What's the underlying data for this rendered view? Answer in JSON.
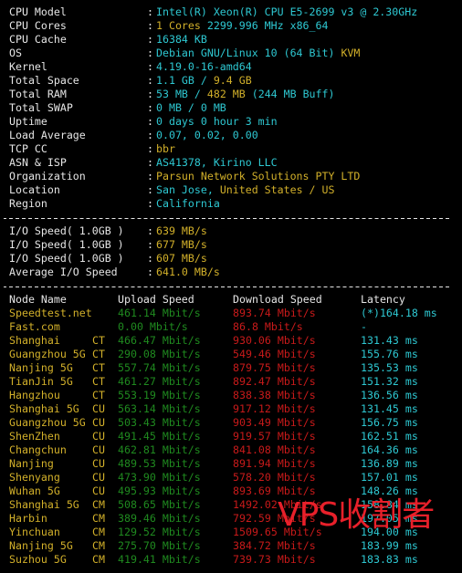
{
  "colors": {
    "label": "#e6e6e6",
    "cyan": "#2ec8d2",
    "yellow": "#d2b02a",
    "green": "#1f8a1f",
    "red": "#c81a1a",
    "watermark": "#e8202a"
  },
  "system": {
    "cpu_model": {
      "label": "CPU Model",
      "value": "Intel(R) Xeon(R) CPU E5-2699 v3 @ 2.30GHz"
    },
    "cpu_cores": {
      "label": "CPU Cores",
      "count": "1 Cores",
      "rest": "2299.996 MHz x86_64"
    },
    "cpu_cache": {
      "label": "CPU Cache",
      "value": "16384 KB"
    },
    "os": {
      "label": "OS",
      "value": "Debian GNU/Linux 10 (64 Bit)",
      "virt": "KVM"
    },
    "kernel": {
      "label": "Kernel",
      "value": "4.19.0-16-amd64"
    },
    "total_space": {
      "label": "Total Space",
      "used": "1.1 GB /",
      "total": "9.4 GB"
    },
    "total_ram": {
      "label": "Total RAM",
      "used": "53 MB /",
      "total": "482 MB",
      "extra": "(244 MB Buff)"
    },
    "total_swap": {
      "label": "Total SWAP",
      "value": "0 MB / 0 MB"
    },
    "uptime": {
      "label": "Uptime",
      "value": "0 days 0 hour 3 min"
    },
    "load_average": {
      "label": "Load Average",
      "value": "0.07, 0.02, 0.00"
    },
    "tcp_cc": {
      "label": "TCP CC",
      "value": "bbr"
    },
    "asn_isp": {
      "label": "ASN & ISP",
      "value": "AS41378, Kirino LLC"
    },
    "organization": {
      "label": "Organization",
      "value": "Parsun Network Solutions PTY LTD"
    },
    "location": {
      "label": "Location",
      "city": "San Jose,",
      "country": "United States / US"
    },
    "region": {
      "label": "Region",
      "value": "California"
    }
  },
  "separator_colon": ":",
  "io": [
    {
      "label": "I/O Speed( 1.0GB )",
      "value": "639 MB/s"
    },
    {
      "label": "I/O Speed( 1.0GB )",
      "value": "677 MB/s"
    },
    {
      "label": "I/O Speed( 1.0GB )",
      "value": "607 MB/s"
    },
    {
      "label": "Average I/O Speed",
      "value": "641.0 MB/s"
    }
  ],
  "speedtest": {
    "headers": {
      "node": "Node Name",
      "upload": "Upload Speed",
      "download": "Download Speed",
      "latency": "Latency"
    },
    "rows": [
      {
        "node": "Speedtest.net",
        "isp": "",
        "upload": "461.14 Mbit/s",
        "download": "893.74 Mbit/s",
        "latency": "(*)164.18 ms"
      },
      {
        "node": "Fast.com",
        "isp": "",
        "upload": "0.00 Mbit/s",
        "download": "86.8 Mbit/s",
        "latency": "-"
      },
      {
        "node": "Shanghai",
        "isp": "CT",
        "upload": "466.47 Mbit/s",
        "download": "930.06 Mbit/s",
        "latency": "131.43 ms"
      },
      {
        "node": "Guangzhou 5G",
        "isp": "CT",
        "upload": "290.08 Mbit/s",
        "download": "549.46 Mbit/s",
        "latency": "155.76 ms"
      },
      {
        "node": "Nanjing 5G",
        "isp": "CT",
        "upload": "557.74 Mbit/s",
        "download": "879.75 Mbit/s",
        "latency": "135.53 ms"
      },
      {
        "node": "TianJin 5G",
        "isp": "CT",
        "upload": "461.27 Mbit/s",
        "download": "892.47 Mbit/s",
        "latency": "151.32 ms"
      },
      {
        "node": "Hangzhou",
        "isp": "CT",
        "upload": "553.19 Mbit/s",
        "download": "838.38 Mbit/s",
        "latency": "136.56 ms"
      },
      {
        "node": "Shanghai 5G",
        "isp": "CU",
        "upload": "563.14 Mbit/s",
        "download": "917.12 Mbit/s",
        "latency": "131.45 ms"
      },
      {
        "node": "Guangzhou 5G",
        "isp": "CU",
        "upload": "503.43 Mbit/s",
        "download": "903.49 Mbit/s",
        "latency": "156.75 ms"
      },
      {
        "node": "ShenZhen",
        "isp": "CU",
        "upload": "491.45 Mbit/s",
        "download": "919.57 Mbit/s",
        "latency": "162.51 ms"
      },
      {
        "node": "Changchun",
        "isp": "CU",
        "upload": "462.81 Mbit/s",
        "download": "841.08 Mbit/s",
        "latency": "164.36 ms"
      },
      {
        "node": "Nanjing",
        "isp": "CU",
        "upload": "489.53 Mbit/s",
        "download": "891.94 Mbit/s",
        "latency": "136.89 ms"
      },
      {
        "node": "Shenyang",
        "isp": "CU",
        "upload": "473.90 Mbit/s",
        "download": "578.20 Mbit/s",
        "latency": "157.01 ms"
      },
      {
        "node": "Wuhan 5G",
        "isp": "CU",
        "upload": "495.93 Mbit/s",
        "download": "893.69 Mbit/s",
        "latency": "148.26 ms"
      },
      {
        "node": "Shanghai 5G",
        "isp": "CM",
        "upload": "508.65 Mbit/s",
        "download": "1492.02 Mbit/s",
        "latency": "158.84 ms"
      },
      {
        "node": "Harbin",
        "isp": "CM",
        "upload": "389.46 Mbit/s",
        "download": "792.59 Mbit/s",
        "latency": "197.05 ms"
      },
      {
        "node": "Yinchuan",
        "isp": "CM",
        "upload": "129.52 Mbit/s",
        "download": "1509.65 Mbit/s",
        "latency": "194.00 ms"
      },
      {
        "node": "Nanjing 5G",
        "isp": "CM",
        "upload": "275.70 Mbit/s",
        "download": "384.72 Mbit/s",
        "latency": "183.99 ms"
      },
      {
        "node": "Suzhou 5G",
        "isp": "CM",
        "upload": "419.41 Mbit/s",
        "download": "739.73 Mbit/s",
        "latency": "183.83 ms"
      }
    ]
  },
  "watermark": "VPS收割者"
}
